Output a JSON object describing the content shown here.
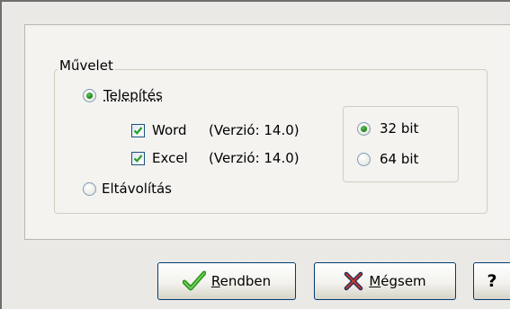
{
  "dialog": {
    "group_title": "Művelet",
    "install_label": "Telepítés",
    "uninstall_label": "Eltávolítás",
    "products": [
      {
        "name": "Word",
        "version": "(Verzió: 14.0)",
        "checked": true
      },
      {
        "name": "Excel",
        "version": "(Verzió: 14.0)",
        "checked": true
      }
    ],
    "bitness": {
      "option_32": "32 bit",
      "option_64": "64 bit",
      "selected": "32 bit"
    },
    "selected_action": "Telepítés"
  },
  "buttons": {
    "ok_first": "R",
    "ok_rest": "endben",
    "cancel_first": "M",
    "cancel_rest": "égsem",
    "help": "?"
  },
  "icons": {
    "ok": "check-icon",
    "cancel": "x-icon",
    "ok_color": "#2e9a1e",
    "cancel_color": "#1a2a5a"
  }
}
